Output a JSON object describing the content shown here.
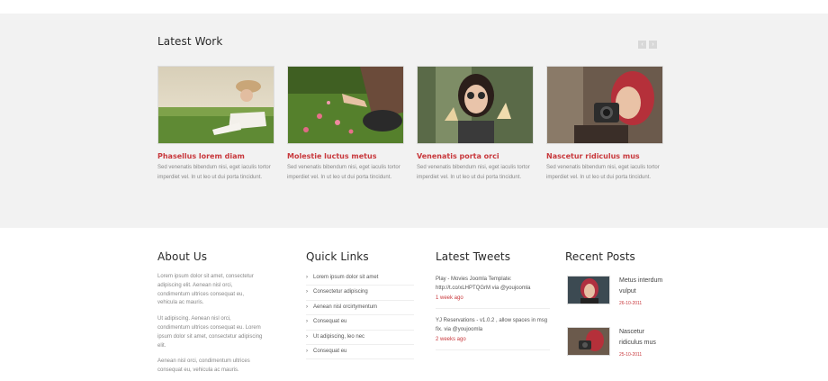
{
  "latest_work": {
    "title": "Latest Work",
    "prev_icon": "chevron-left-icon",
    "next_icon": "chevron-right-icon",
    "items": [
      {
        "title": "Phasellus lorem diam",
        "desc": "Sed venenatis bibendum nisi, eget iaculis tortor imperdiet vel. In ut leo ut dui porta tincidunt."
      },
      {
        "title": "Molestie luctus metus",
        "desc": "Sed venenatis bibendum nisi, eget iaculis tortor imperdiet vel. In ut leo ut dui porta tincidunt."
      },
      {
        "title": "Venenatis porta orci",
        "desc": "Sed venenatis bibendum nisi, eget iaculis tortor imperdiet vel. In ut leo ut dui porta tincidunt."
      },
      {
        "title": "Nascetur ridiculus mus",
        "desc": "Sed venenatis bibendum nisi, eget iaculis tortor imperdiet vel. In ut leo ut dui porta tincidunt."
      }
    ]
  },
  "about": {
    "title": "About Us",
    "paragraphs": [
      "Lorem ipsum dolor sit amet, consectetur adipiscing elit. Aenean nisl orci, condimentum ultrices consequat eu, vehicula ac mauris.",
      "Ut adipiscing. Aenean nisl orci, condimentum ultrices consequat eu. Lorem ipsum dolor sit amet, consectetur adipiscing elit.",
      "Aenean nisl orci, condimentum ultrices consequat eu, vehicula ac mauris."
    ]
  },
  "quick_links": {
    "title": "Quick Links",
    "items": [
      "Lorem ipsum dolor sit amet",
      "Consectetur adipiscing",
      "Aenean nisl orcirtymentum",
      "Consequat eu",
      "Ut adipiscing, leo nec",
      "Consequat eu"
    ]
  },
  "tweets": {
    "title": "Latest Tweets",
    "items": [
      {
        "text": "Play - Movies Joomla Template: http://t.co/xLHPTQGrM via @youjoomla",
        "time": "1 week ago"
      },
      {
        "text": "YJ Reservations - v1.0.2 , allow spaces in msg fix. via @youjoomla",
        "time": "2 weeks ago"
      }
    ]
  },
  "recent_posts": {
    "title": "Recent Posts",
    "items": [
      {
        "title": "Metus interdum vulput",
        "date": "26-10-2011"
      },
      {
        "title": "Nascetur ridiculus mus",
        "date": "25-10-2011"
      }
    ]
  },
  "colors": {
    "accent": "#c8383c",
    "band_background": "#f2f2f2",
    "body_text": "#888888"
  }
}
